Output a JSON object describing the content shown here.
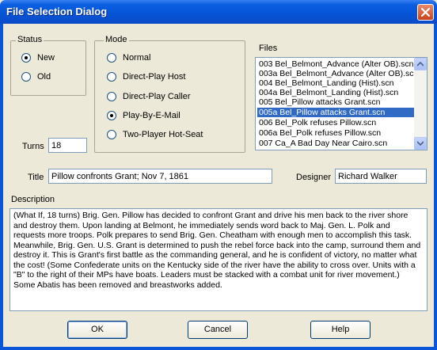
{
  "window": {
    "title": "File Selection Dialog"
  },
  "status": {
    "label": "Status",
    "options": [
      {
        "label": "New",
        "selected": true
      },
      {
        "label": "Old",
        "selected": false
      }
    ]
  },
  "mode": {
    "label": "Mode",
    "options": [
      {
        "label": "Normal",
        "selected": false
      },
      {
        "label": "Direct-Play Host",
        "selected": false
      },
      {
        "label": "Direct-Play Caller",
        "selected": false
      },
      {
        "label": "Play-By-E-Mail",
        "selected": true
      },
      {
        "label": "Two-Player Hot-Seat",
        "selected": false
      }
    ]
  },
  "files": {
    "label": "Files",
    "items": [
      "003 Bel_Belmont_Advance (Alter OB).scn",
      "003a Bel_Belmont_Advance (Alter OB).scn",
      "004 Bel_Belmont_Landing (Hist).scn",
      "004a Bel_Belmont_Landing (Hist).scn",
      "005 Bel_Pillow attacks Grant.scn",
      "005a Bel_Pillow attacks Grant.scn",
      "006 Bel_Polk refuses Pillow.scn",
      "006a Bel_Polk refuses Pillow.scn",
      "007 Ca_A Bad Day Near Cairo.scn"
    ],
    "selected_index": 5
  },
  "turns": {
    "label": "Turns",
    "value": "18"
  },
  "title_field": {
    "label": "Title",
    "value": "Pillow confronts Grant; Nov 7, 1861"
  },
  "designer": {
    "label": "Designer",
    "value": "Richard Walker"
  },
  "description": {
    "label": "Description",
    "text": "(What If, 18 turns) Brig. Gen. Pillow has decided to confront Grant and drive his men back to the river shore and destroy them.  Upon landing at Belmont, he immediately sends word back to Maj. Gen. L. Polk and requests more troops.  Polk prepares to send Brig. Gen. Cheatham with enough men to accomplish this task.  Meanwhile, Brig. Gen. U.S. Grant is determined to push the rebel force back into the camp, surround them and destroy it.  This is Grant's first battle as the commanding general, and he is confident of victory, no matter what the cost! (Some Confederate units on the Kentucky side of the river have the ability to cross over.  Units with a \"B\" to the right of their MPs have boats. Leaders must be stacked with a combat unit for river movement.) Some Abatis has been removed and breastworks added."
  },
  "buttons": {
    "ok": "OK",
    "cancel": "Cancel",
    "help": "Help"
  },
  "icons": {
    "close": "close-icon",
    "scroll_up": "arrow-up-icon",
    "scroll_down": "arrow-down-icon"
  },
  "colors": {
    "titlebar": "#0a5fe0",
    "selection": "#316ac5",
    "dialog_bg": "#ece9d8",
    "close": "#c9431b"
  }
}
